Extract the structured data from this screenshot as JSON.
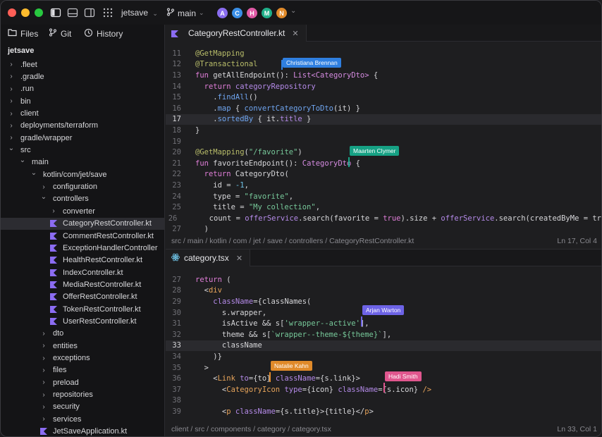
{
  "window": {
    "project_name": "jetsave",
    "branch": "main",
    "collaborators": [
      {
        "initial": "A",
        "color": "#8a6df0"
      },
      {
        "initial": "C",
        "color": "#3a8ee6"
      },
      {
        "initial": "H",
        "color": "#e05aa6"
      },
      {
        "initial": "M",
        "color": "#20b08a"
      },
      {
        "initial": "N",
        "color": "#e08a2a"
      }
    ]
  },
  "sidebar": {
    "tabs": [
      {
        "label": "Files"
      },
      {
        "label": "Git"
      },
      {
        "label": "History"
      }
    ],
    "root": "jetsave",
    "tree": [
      {
        "label": ".fleet",
        "type": "folder"
      },
      {
        "label": ".gradle",
        "type": "folder"
      },
      {
        "label": ".run",
        "type": "folder"
      },
      {
        "label": "bin",
        "type": "folder"
      },
      {
        "label": "client",
        "type": "folder"
      },
      {
        "label": "deployments/terraform",
        "type": "folder"
      },
      {
        "label": "gradle/wrapper",
        "type": "folder"
      },
      {
        "label": "src",
        "type": "folder-open"
      },
      {
        "label": "main",
        "type": "folder-open"
      },
      {
        "label": "kotlin/com/jet/save",
        "type": "folder-open"
      },
      {
        "label": "configuration",
        "type": "folder"
      },
      {
        "label": "controllers",
        "type": "folder-open"
      },
      {
        "label": "converter",
        "type": "folder"
      },
      {
        "label": "CategoryRestController.kt",
        "type": "kt"
      },
      {
        "label": "CommentRestController.kt",
        "type": "kt"
      },
      {
        "label": "ExceptionHandlerController",
        "type": "kt"
      },
      {
        "label": "HealthRestController.kt",
        "type": "kt"
      },
      {
        "label": "IndexController.kt",
        "type": "kt"
      },
      {
        "label": "MediaRestController.kt",
        "type": "kt"
      },
      {
        "label": "OfferRestController.kt",
        "type": "kt"
      },
      {
        "label": "TokenRestController.kt",
        "type": "kt"
      },
      {
        "label": "UserRestController.kt",
        "type": "kt"
      },
      {
        "label": "dto",
        "type": "folder"
      },
      {
        "label": "entities",
        "type": "folder"
      },
      {
        "label": "exceptions",
        "type": "folder"
      },
      {
        "label": "files",
        "type": "folder"
      },
      {
        "label": "preload",
        "type": "folder"
      },
      {
        "label": "repositories",
        "type": "folder"
      },
      {
        "label": "security",
        "type": "folder"
      },
      {
        "label": "services",
        "type": "folder"
      },
      {
        "label": "JetSaveApplication.kt",
        "type": "kt"
      }
    ]
  },
  "editor_top": {
    "tab_label": "CategoryRestController.kt",
    "breadcrumb": "src / main / kotlin / com / jet / save / controllers / CategoryRestController.kt",
    "position": "Ln 17, Col 4",
    "lines": [
      {
        "n": "11",
        "tokens": [
          [
            "@GetMapping",
            "ann"
          ]
        ]
      },
      {
        "n": "12",
        "tokens": [
          [
            "@Transactional",
            "ann"
          ]
        ]
      },
      {
        "n": "13",
        "tokens": [
          [
            "fun ",
            "kw"
          ],
          [
            "getAllEndpoint",
            "plain"
          ],
          [
            "(): ",
            "plain"
          ],
          [
            "List<CategoryDto>",
            "type"
          ],
          [
            " {",
            "plain"
          ]
        ]
      },
      {
        "n": "14",
        "tokens": [
          [
            "  return ",
            "kw"
          ],
          [
            "categoryRepository",
            "prop"
          ]
        ]
      },
      {
        "n": "15",
        "tokens": [
          [
            "    .",
            "plain"
          ],
          [
            "findAll",
            "fn"
          ],
          [
            "()",
            "plain"
          ]
        ]
      },
      {
        "n": "16",
        "tokens": [
          [
            "    .",
            "plain"
          ],
          [
            "map",
            "fn"
          ],
          [
            " { ",
            "plain"
          ],
          [
            "convertCategoryToDto",
            "fn"
          ],
          [
            "(it) }",
            "plain"
          ]
        ]
      },
      {
        "n": "17",
        "tokens": [
          [
            "    .",
            "plain"
          ],
          [
            "sortedBy",
            "fn"
          ],
          [
            " { it.",
            "plain"
          ],
          [
            "title",
            "prop"
          ],
          [
            " }",
            "plain"
          ]
        ]
      },
      {
        "n": "18",
        "tokens": [
          [
            "}",
            "plain"
          ]
        ]
      },
      {
        "n": "19",
        "tokens": []
      },
      {
        "n": "20",
        "tokens": [
          [
            "@GetMapping",
            "ann"
          ],
          [
            "(",
            "plain"
          ],
          [
            "\"/favorite\"",
            "str"
          ],
          [
            ")",
            "plain"
          ]
        ]
      },
      {
        "n": "21",
        "tokens": [
          [
            "fun ",
            "kw"
          ],
          [
            "favoriteEndpoint",
            "plain"
          ],
          [
            "(): ",
            "plain"
          ],
          [
            "CategoryDto",
            "type"
          ],
          [
            " {",
            "plain"
          ]
        ]
      },
      {
        "n": "22",
        "tokens": [
          [
            "  return ",
            "kw"
          ],
          [
            "CategoryDto(",
            "plain"
          ]
        ]
      },
      {
        "n": "23",
        "tokens": [
          [
            "    id = ",
            "plain"
          ],
          [
            "-1",
            "num"
          ],
          [
            ",",
            "plain"
          ]
        ]
      },
      {
        "n": "24",
        "tokens": [
          [
            "    type = ",
            "plain"
          ],
          [
            "\"favorite\"",
            "str"
          ],
          [
            ",",
            "plain"
          ]
        ]
      },
      {
        "n": "25",
        "tokens": [
          [
            "    title = ",
            "plain"
          ],
          [
            "\"My collection\"",
            "str"
          ],
          [
            ",",
            "plain"
          ]
        ]
      },
      {
        "n": "26",
        "tokens": [
          [
            "    count = ",
            "plain"
          ],
          [
            "offerService",
            "prop"
          ],
          [
            ".search(favorite = ",
            "plain"
          ],
          [
            "true",
            "kw"
          ],
          [
            ").size + ",
            "plain"
          ],
          [
            "offerService",
            "prop"
          ],
          [
            ".search(createdByMe = tr",
            "plain"
          ]
        ]
      },
      {
        "n": "27",
        "tokens": [
          [
            "  )",
            "plain"
          ]
        ]
      }
    ]
  },
  "editor_bottom": {
    "tab_label": "category.tsx",
    "breadcrumb": "client / src / components / category / category.tsx",
    "position": "Ln 33, Col 1",
    "lines": [
      {
        "n": "27",
        "tokens": [
          [
            "return ",
            "kw"
          ],
          [
            "(",
            "plain"
          ]
        ]
      },
      {
        "n": "28",
        "tokens": [
          [
            "  <",
            "plain"
          ],
          [
            "div",
            "tag"
          ]
        ]
      },
      {
        "n": "29",
        "tokens": [
          [
            "    ",
            "plain"
          ],
          [
            "className",
            "attr"
          ],
          [
            "={classNames(",
            "plain"
          ]
        ]
      },
      {
        "n": "30",
        "tokens": [
          [
            "      s.wrapper,",
            "plain"
          ]
        ]
      },
      {
        "n": "31",
        "tokens": [
          [
            "      isActive && s[",
            "plain"
          ],
          [
            "'wrapper--active'",
            "str"
          ],
          [
            "],",
            "plain"
          ]
        ]
      },
      {
        "n": "32",
        "tokens": [
          [
            "      theme && s[",
            "plain"
          ],
          [
            "`wrapper--theme-${theme}`",
            "str"
          ],
          [
            "],",
            "plain"
          ]
        ]
      },
      {
        "n": "33",
        "tokens": [
          [
            "      className",
            "plain"
          ]
        ]
      },
      {
        "n": "34",
        "tokens": [
          [
            "    )}",
            "plain"
          ]
        ]
      },
      {
        "n": "35",
        "tokens": [
          [
            "  >",
            "plain"
          ]
        ]
      },
      {
        "n": "36",
        "tokens": [
          [
            "    <",
            "plain"
          ],
          [
            "Link",
            "tag"
          ],
          [
            " ",
            "plain"
          ],
          [
            "to",
            "attr"
          ],
          [
            "={to} ",
            "plain"
          ],
          [
            "className",
            "attr"
          ],
          [
            "={s.link}>",
            "plain"
          ]
        ]
      },
      {
        "n": "37",
        "tokens": [
          [
            "      <",
            "plain"
          ],
          [
            "CategoryIcon",
            "tag"
          ],
          [
            " ",
            "plain"
          ],
          [
            "type",
            "attr"
          ],
          [
            "={icon} ",
            "plain"
          ],
          [
            "className",
            "attr"
          ],
          [
            "={s.icon} ",
            "plain"
          ],
          [
            "/>",
            "tag"
          ]
        ]
      },
      {
        "n": "38",
        "tokens": []
      },
      {
        "n": "39",
        "tokens": [
          [
            "      <",
            "plain"
          ],
          [
            "p",
            "tag"
          ],
          [
            " ",
            "plain"
          ],
          [
            "className",
            "attr"
          ],
          [
            "={s.title}>{title}</",
            "plain"
          ],
          [
            "p",
            "tag"
          ],
          [
            ">",
            "plain"
          ]
        ]
      }
    ]
  },
  "collab_labels": [
    {
      "name": "Christiana Brennan",
      "color": "#2f7fe0"
    },
    {
      "name": "Maarten Clymer",
      "color": "#16a184"
    },
    {
      "name": "Arjan Warton",
      "color": "#6d63e6"
    },
    {
      "name": "Natalie Kahn",
      "color": "#e08a2a"
    },
    {
      "name": "Hadi Smith",
      "color": "#e0568e"
    }
  ]
}
